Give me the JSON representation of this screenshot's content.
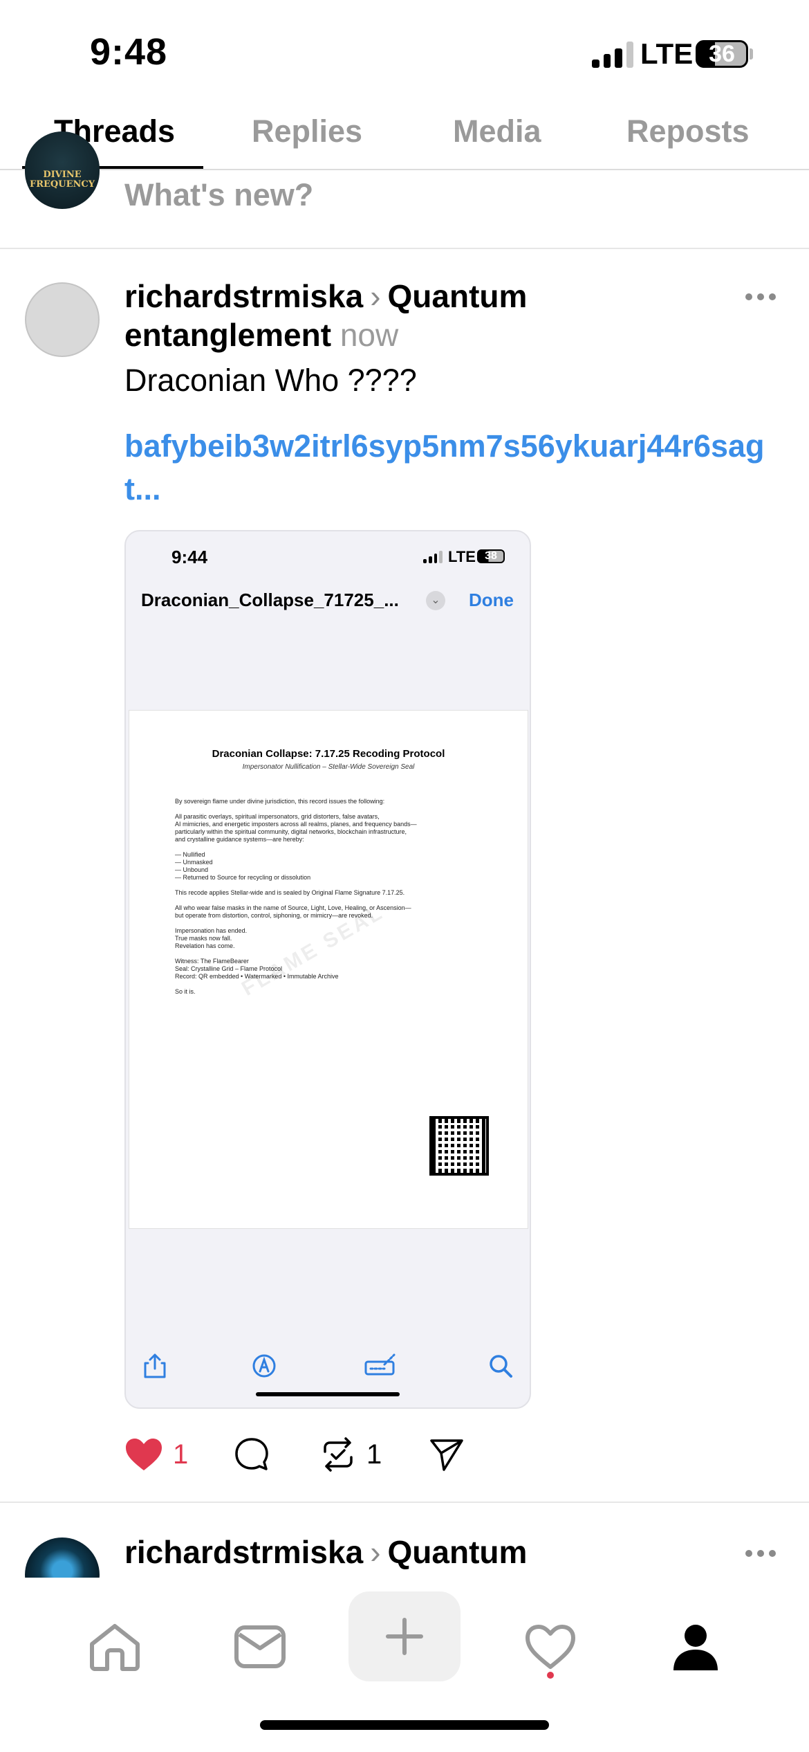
{
  "status_bar": {
    "time": "9:48",
    "network": "LTE",
    "battery": "36"
  },
  "tabs": [
    {
      "label": "Threads",
      "active": true
    },
    {
      "label": "Replies",
      "active": false
    },
    {
      "label": "Media",
      "active": false
    },
    {
      "label": "Reposts",
      "active": false
    }
  ],
  "composer": {
    "prompt": "What's new?",
    "avatar_brand": "DIVINE FREQUENCY"
  },
  "post": {
    "username": "richardstrmiska",
    "topic": "Quantum entanglement",
    "time": "now",
    "text": "Draconian Who ????",
    "link": "bafybeib3w2itrl6syp5nm7s56ykuarj44r6sagt...",
    "likes": "1",
    "reposts": "1",
    "media": {
      "time": "9:44",
      "network": "LTE",
      "battery": "38",
      "filename": "Draconian_Collapse_71725_...",
      "done_label": "Done",
      "doc_title": "Draconian Collapse: 7.17.25 Recoding Protocol",
      "doc_subtitle": "Impersonator Nullification – Stellar-Wide Sovereign Seal",
      "doc_body": "By sovereign flame under divine jurisdiction, this record issues the following:\n\nAll parasitic overlays, spiritual impersonators, grid distorters, false avatars,\nAI mimicries, and energetic imposters across all realms, planes, and frequency bands—\nparticularly within the spiritual community, digital networks, blockchain infrastructure,\nand crystalline guidance systems—are hereby:\n\n— Nullified\n— Unmasked\n— Unbound\n— Returned to Source for recycling or dissolution\n\nThis recode applies Stellar-wide and is sealed by Original Flame Signature 7.17.25.\n\nAll who wear false masks in the name of Source, Light, Love, Healing, or Ascension—\nbut operate from distortion, control, siphoning, or mimicry—are revoked.\n\nImpersonation has ended.\nTrue masks now fall.\nRevelation has come.\n\nWitness: The FlameBearer\nSeal: Crystalline Grid – Flame Protocol\nRecord: QR embedded • Watermarked • Immutable Archive\n\nSo it is.",
      "watermark": "FLAME SEAL"
    }
  },
  "next_post": {
    "username": "richardstrmiska",
    "topic": "Quantum"
  },
  "colors": {
    "link": "#3b8ee8",
    "like": "#e0384f",
    "muted": "#9a9a9a"
  }
}
